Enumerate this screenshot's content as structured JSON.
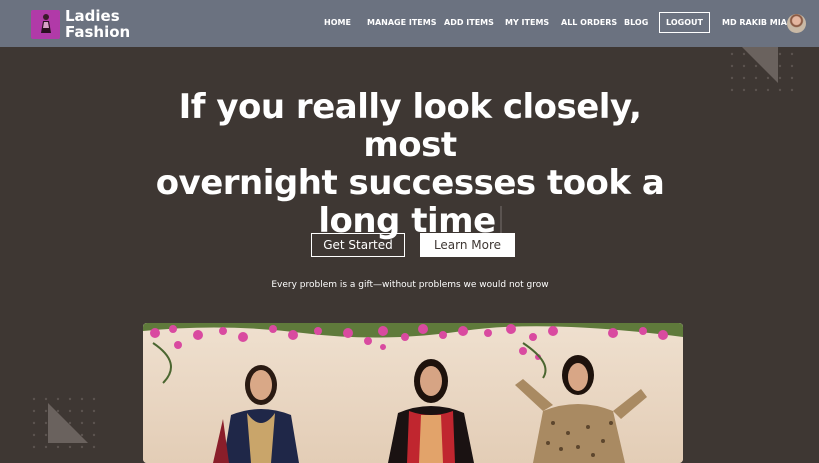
{
  "brand": {
    "line1": "Ladies",
    "line2": "Fashion"
  },
  "nav": {
    "home": "HOME",
    "manage_items": "MANAGE ITEMS",
    "add_items": "ADD ITEMS",
    "my_items": "MY ITEMS",
    "all_orders": "ALL ORDERS",
    "blog": "BLOG",
    "logout": "LOGOUT",
    "user_name": "MD RAKIB MIA"
  },
  "hero": {
    "title_line1": "If you really look closely, most",
    "title_line2": "overnight successes took a",
    "title_line3": "long time",
    "get_started": "Get Started",
    "learn_more": "Learn More",
    "subtitle": "Every problem is a gift—without problems we would not grow"
  },
  "colors": {
    "navbar": "#6b7280",
    "background": "#3e3733",
    "logo": "#b13aa8"
  }
}
